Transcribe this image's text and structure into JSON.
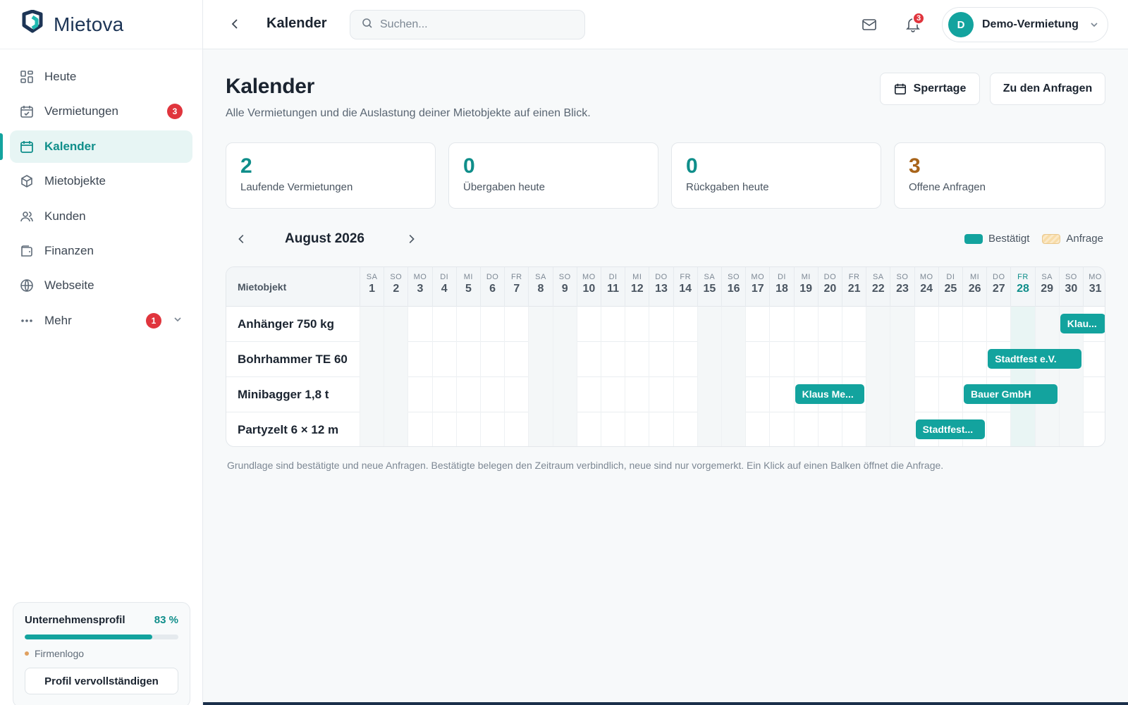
{
  "brand": {
    "name": "Mietova"
  },
  "sidebar": {
    "items": [
      {
        "label": "Heute",
        "icon": "grid-icon"
      },
      {
        "label": "Vermietungen",
        "icon": "calendar-check-icon",
        "badge": "3"
      },
      {
        "label": "Kalender",
        "icon": "calendar-icon",
        "active": true
      },
      {
        "label": "Mietobjekte",
        "icon": "box-icon"
      },
      {
        "label": "Kunden",
        "icon": "users-icon"
      },
      {
        "label": "Finanzen",
        "icon": "wallet-icon"
      },
      {
        "label": "Webseite",
        "icon": "globe-icon"
      },
      {
        "label": "Mehr",
        "icon": "more-icon",
        "badge": "1"
      }
    ],
    "profile": {
      "title": "Unternehmensprofil",
      "percent": "83 %",
      "progress": 0.83,
      "todo": "Firmenlogo",
      "button": "Profil vervollständigen"
    }
  },
  "topbar": {
    "title": "Kalender",
    "search_placeholder": "Suchen...",
    "notifications": "3",
    "account_initial": "D",
    "account_name": "Demo-Vermietung"
  },
  "page": {
    "title": "Kalender",
    "subtitle": "Alle Vermietungen und die Auslastung deiner Mietobjekte auf einen Blick.",
    "btn_sperrtage": "Sperrtage",
    "btn_anfragen": "Zu den Anfragen"
  },
  "stats": [
    {
      "value": "2",
      "label": "Laufende Vermietungen"
    },
    {
      "value": "0",
      "label": "Übergaben heute"
    },
    {
      "value": "0",
      "label": "Rückgaben heute"
    },
    {
      "value": "3",
      "label": "Offene Anfragen"
    }
  ],
  "calendar": {
    "month": "August 2026",
    "legend_confirmed": "Bestätigt",
    "legend_request": "Anfrage",
    "column_header": "Mietobjekt",
    "today": 28,
    "days": [
      [
        "SA",
        "1"
      ],
      [
        "SO",
        "2"
      ],
      [
        "MO",
        "3"
      ],
      [
        "DI",
        "4"
      ],
      [
        "MI",
        "5"
      ],
      [
        "DO",
        "6"
      ],
      [
        "FR",
        "7"
      ],
      [
        "SA",
        "8"
      ],
      [
        "SO",
        "9"
      ],
      [
        "MO",
        "10"
      ],
      [
        "DI",
        "11"
      ],
      [
        "MI",
        "12"
      ],
      [
        "DO",
        "13"
      ],
      [
        "FR",
        "14"
      ],
      [
        "SA",
        "15"
      ],
      [
        "SO",
        "16"
      ],
      [
        "MO",
        "17"
      ],
      [
        "DI",
        "18"
      ],
      [
        "MI",
        "19"
      ],
      [
        "DO",
        "20"
      ],
      [
        "FR",
        "21"
      ],
      [
        "SA",
        "22"
      ],
      [
        "SO",
        "23"
      ],
      [
        "MO",
        "24"
      ],
      [
        "DI",
        "25"
      ],
      [
        "MI",
        "26"
      ],
      [
        "DO",
        "27"
      ],
      [
        "FR",
        "28"
      ],
      [
        "SA",
        "29"
      ],
      [
        "SO",
        "30"
      ],
      [
        "MO",
        "31"
      ]
    ],
    "rows": [
      {
        "name": "Anhänger 750 kg",
        "bookings": [
          {
            "label": "Klau...",
            "start": 30,
            "end": 31
          }
        ]
      },
      {
        "name": "Bohrhammer TE 60",
        "bookings": [
          {
            "label": "Stadtfest e.V.",
            "start": 27,
            "end": 30
          }
        ]
      },
      {
        "name": "Minibagger 1,8 t",
        "bookings": [
          {
            "label": "Klaus Me...",
            "start": 19,
            "end": 21
          },
          {
            "label": "Bauer GmbH",
            "start": 26,
            "end": 29
          }
        ]
      },
      {
        "name": "Partyzelt 6 × 12 m",
        "bookings": [
          {
            "label": "Stadtfest...",
            "start": 24,
            "end": 26
          }
        ]
      }
    ],
    "footnote": "Grundlage sind bestätigte und neue Anfragen. Bestätigte belegen den Zeitraum verbindlich, neue sind nur vorgemerkt. Ein Klick auf einen Balken öffnet die Anfrage."
  }
}
